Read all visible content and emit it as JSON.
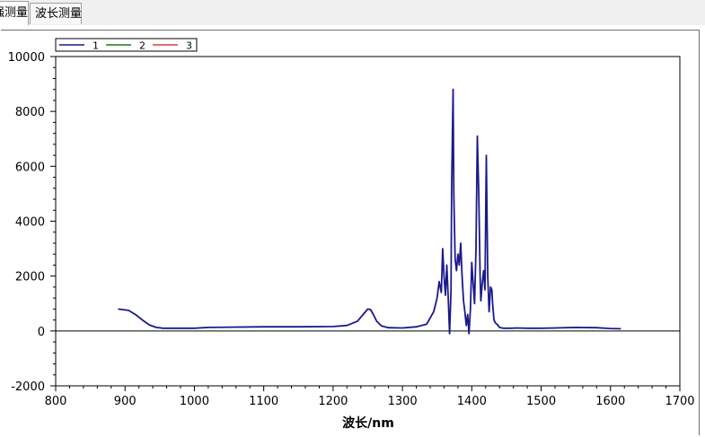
{
  "tabs": [
    {
      "label": "强测量",
      "active": true
    },
    {
      "label": "波长测量",
      "active": false
    }
  ],
  "chart_data": {
    "type": "line",
    "title": "",
    "xlabel": "波长/nm",
    "ylabel": "",
    "xlim": [
      800,
      1700
    ],
    "ylim": [
      -2000,
      10000
    ],
    "x_ticks": [
      800,
      900,
      1000,
      1100,
      1200,
      1300,
      1400,
      1500,
      1600,
      1700
    ],
    "y_ticks": [
      -2000,
      0,
      2000,
      4000,
      6000,
      8000,
      10000
    ],
    "grid": true,
    "legend": "top-left",
    "series": [
      {
        "name": "1",
        "color": "#1a1a8c",
        "x": [
          890,
          905,
          915,
          925,
          935,
          945,
          955,
          965,
          980,
          1000,
          1020,
          1050,
          1100,
          1150,
          1200,
          1220,
          1235,
          1245,
          1250,
          1254,
          1258,
          1263,
          1270,
          1280,
          1300,
          1320,
          1335,
          1345,
          1350,
          1353,
          1356,
          1358,
          1360,
          1362,
          1364,
          1366,
          1368,
          1370,
          1371,
          1373,
          1374,
          1376,
          1378,
          1380,
          1382,
          1384,
          1386,
          1388,
          1390,
          1392,
          1394,
          1396,
          1398,
          1400,
          1402,
          1404,
          1406,
          1408,
          1410,
          1412,
          1413,
          1415,
          1417,
          1419,
          1421,
          1423,
          1425,
          1427,
          1429,
          1430,
          1432,
          1434,
          1436,
          1438,
          1440,
          1445,
          1450,
          1455,
          1465,
          1480,
          1500,
          1520,
          1550,
          1580,
          1600,
          1615
        ],
        "y": [
          800,
          750,
          600,
          400,
          220,
          130,
          100,
          100,
          100,
          100,
          130,
          140,
          150,
          150,
          160,
          200,
          350,
          650,
          800,
          780,
          600,
          350,
          180,
          120,
          110,
          150,
          250,
          700,
          1200,
          1800,
          1400,
          3000,
          2000,
          1300,
          2400,
          1200,
          -100,
          1500,
          5200,
          8800,
          5000,
          2600,
          2200,
          2800,
          2400,
          3200,
          2000,
          1100,
          700,
          200,
          600,
          -100,
          800,
          2500,
          1700,
          1000,
          3000,
          7100,
          5000,
          2000,
          1100,
          1700,
          2200,
          1500,
          6400,
          2000,
          700,
          1600,
          1500,
          1000,
          400,
          300,
          250,
          200,
          130,
          100,
          100,
          100,
          110,
          100,
          100,
          110,
          130,
          120,
          90,
          80
        ]
      },
      {
        "name": "2",
        "color": "#1a7a1a",
        "x": [],
        "y": []
      },
      {
        "name": "3",
        "color": "#d04040",
        "x": [],
        "y": []
      }
    ]
  }
}
